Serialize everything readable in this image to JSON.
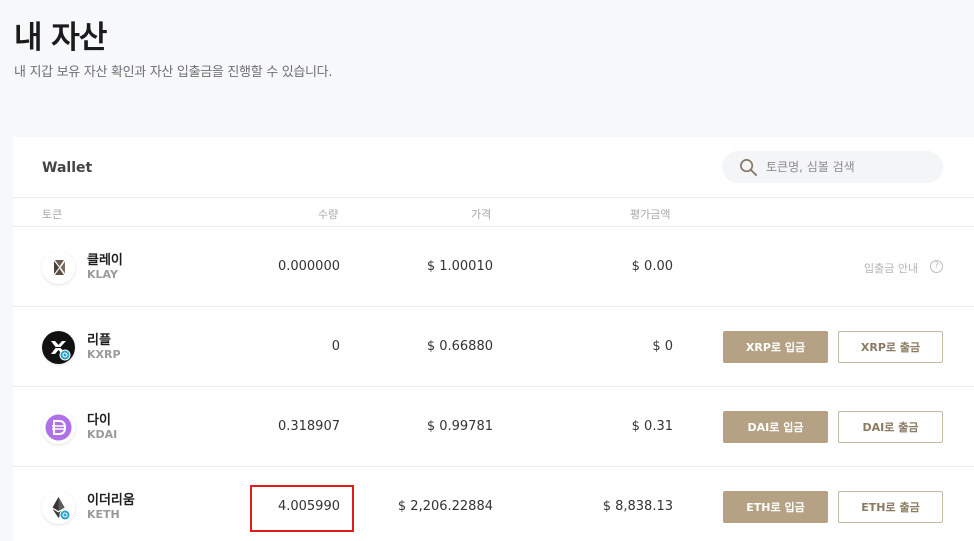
{
  "page": {
    "title": "내 자산",
    "subtitle": "내 지갑 보유 자산 확인과 자산 입출금을 진행할 수 있습니다."
  },
  "wallet": {
    "title": "Wallet",
    "search_placeholder": "토큰명, 심볼 검색"
  },
  "table": {
    "headers": {
      "token": "토큰",
      "quantity": "수량",
      "price": "가격",
      "value": "평가금액"
    },
    "rows": [
      {
        "name": "클레이",
        "symbol": "KLAY",
        "quantity": "0.000000",
        "price": "$ 1.00010",
        "value": "$ 0.00",
        "guide": "입출금 안내",
        "help": "?",
        "icon": "klay-icon"
      },
      {
        "name": "리플",
        "symbol": "KXRP",
        "quantity": "0",
        "price": "$ 0.66880",
        "value": "$ 0",
        "deposit": "XRP로 입금",
        "withdraw": "XRP로 출금",
        "icon": "xrp-icon"
      },
      {
        "name": "다이",
        "symbol": "KDAI",
        "quantity": "0.318907",
        "price": "$ 0.99781",
        "value": "$ 0.31",
        "deposit": "DAI로 입금",
        "withdraw": "DAI로 출금",
        "icon": "dai-icon"
      },
      {
        "name": "이더리움",
        "symbol": "KETH",
        "quantity": "4.005990",
        "price": "$ 2,206.22884",
        "value": "$ 8,838.13",
        "deposit": "ETH로 입금",
        "withdraw": "ETH로 출금",
        "icon": "eth-icon"
      }
    ]
  },
  "colors": {
    "background": "#f7f8fa",
    "accent": "#b5a183",
    "highlight": "#e11b1b",
    "dai": "#b070e8"
  }
}
